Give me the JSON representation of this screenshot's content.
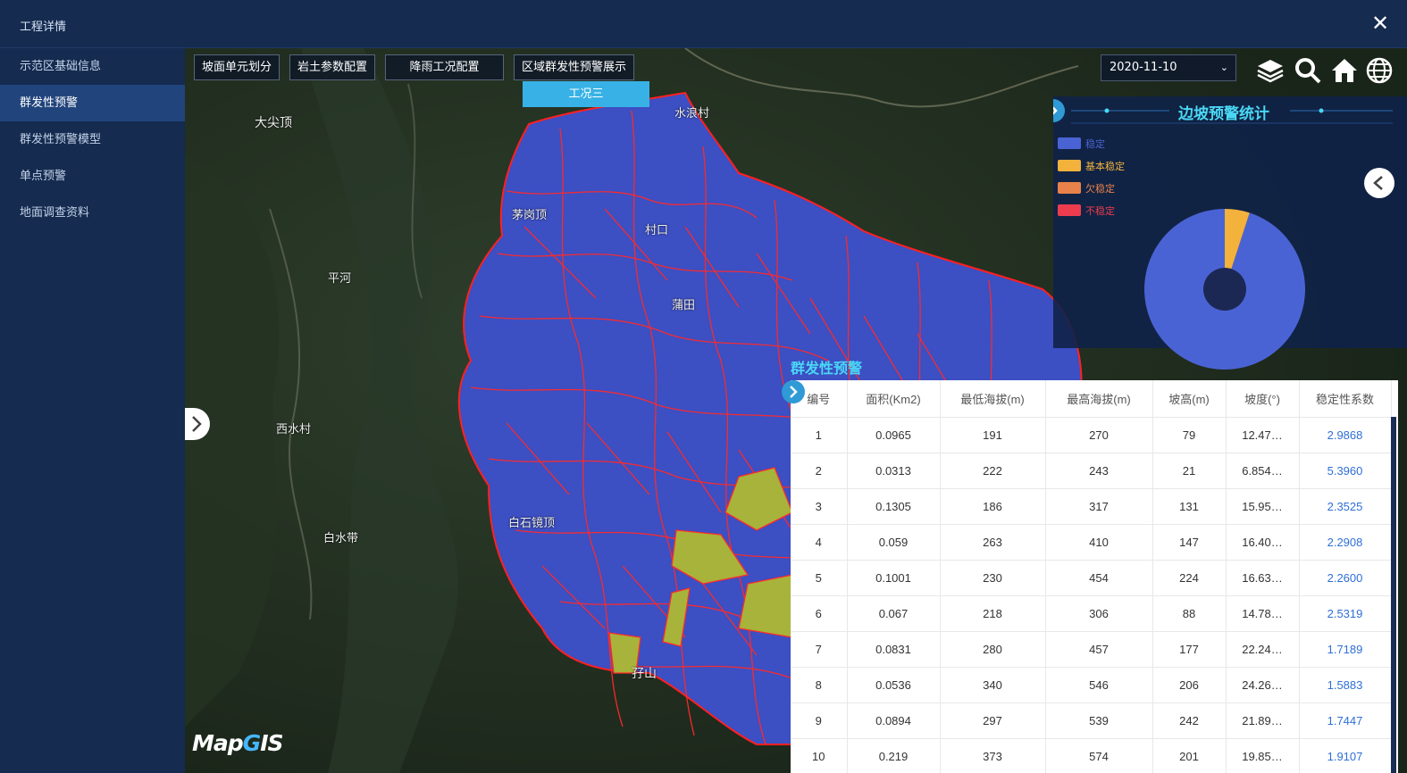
{
  "window": {
    "title": "工程详情",
    "close_icon": "close-icon"
  },
  "sidebar": {
    "items": [
      {
        "label": "示范区基础信息",
        "active": false
      },
      {
        "label": "群发性预警",
        "active": true
      },
      {
        "label": "群发性预警模型",
        "active": false
      },
      {
        "label": "单点预警",
        "active": false
      },
      {
        "label": "地面调查资料",
        "active": false
      }
    ]
  },
  "toolbar": {
    "buttons": [
      "坡面单元划分",
      "岩土参数配置",
      "降雨工况配置",
      "区域群发性预警展示"
    ],
    "dropdown_option": "工况三",
    "date_value": "2020-11-10",
    "icons": [
      "layers-icon",
      "search-icon",
      "home-icon",
      "globe-icon"
    ]
  },
  "map": {
    "places": [
      "大尖顶",
      "茅岗顶",
      "水浪村",
      "村口",
      "蒲田",
      "平河",
      "西水村",
      "白水带",
      "白石镜顶",
      "孖山"
    ],
    "colors": {
      "unit_fill": "#3b4ec2",
      "unit_border": "#ff1e1e",
      "warning_fill": "#a8b43a"
    }
  },
  "stat_panel": {
    "title": "边坡预警统计",
    "legend": [
      {
        "label": "稳定",
        "color": "#4a63d4"
      },
      {
        "label": "基本稳定",
        "color": "#f2b23c"
      },
      {
        "label": "欠稳定",
        "color": "#e8824a"
      },
      {
        "label": "不稳定",
        "color": "#ec3c4e"
      }
    ],
    "chart_data": {
      "type": "pie",
      "categories": [
        "稳定",
        "基本稳定",
        "欠稳定",
        "不稳定"
      ],
      "values": [
        95,
        5,
        0,
        0
      ],
      "colors": [
        "#4a63d4",
        "#f2b23c",
        "#e8824a",
        "#ec3c4e"
      ],
      "donut": true
    }
  },
  "warning_table": {
    "label": "群发性预警",
    "columns": [
      "编号",
      "面积(Km2)",
      "最低海拔(m)",
      "最高海拔(m)",
      "坡高(m)",
      "坡度(°)",
      "稳定性系数"
    ],
    "rows": [
      [
        "1",
        "0.0965",
        "191",
        "270",
        "79",
        "12.47…",
        "2.9868"
      ],
      [
        "2",
        "0.0313",
        "222",
        "243",
        "21",
        "6.854…",
        "5.3960"
      ],
      [
        "3",
        "0.1305",
        "186",
        "317",
        "131",
        "15.95…",
        "2.3525"
      ],
      [
        "4",
        "0.059",
        "263",
        "410",
        "147",
        "16.40…",
        "2.2908"
      ],
      [
        "5",
        "0.1001",
        "230",
        "454",
        "224",
        "16.63…",
        "2.2600"
      ],
      [
        "6",
        "0.067",
        "218",
        "306",
        "88",
        "14.78…",
        "2.5319"
      ],
      [
        "7",
        "0.0831",
        "280",
        "457",
        "177",
        "22.24…",
        "1.7189"
      ],
      [
        "8",
        "0.0536",
        "340",
        "546",
        "206",
        "24.26…",
        "1.5883"
      ],
      [
        "9",
        "0.0894",
        "297",
        "539",
        "242",
        "21.89…",
        "1.7447"
      ],
      [
        "10",
        "0.219",
        "373",
        "574",
        "201",
        "19.85…",
        "1.9107"
      ]
    ]
  },
  "logo": {
    "text_a": "Map",
    "text_b": "G",
    "text_c": "IS"
  }
}
